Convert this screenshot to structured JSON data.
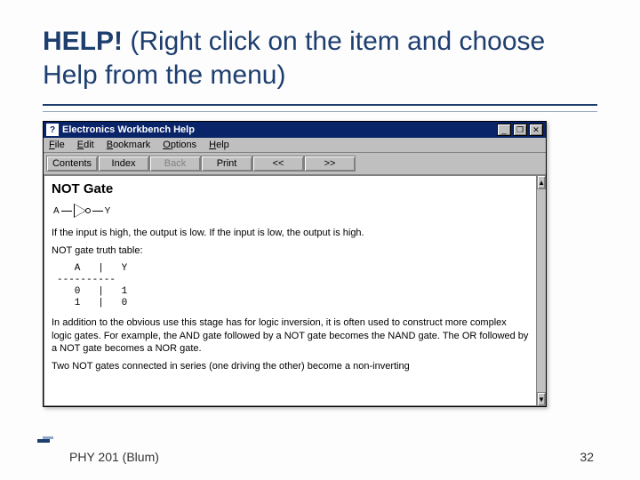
{
  "slide": {
    "title_bold": "HELP!",
    "title_rest": " (Right click on the item and choose Help from the menu)",
    "footer_left": "PHY 201 (Blum)",
    "footer_right": "32"
  },
  "helpwin": {
    "title": "Electronics Workbench Help",
    "menus": [
      "File",
      "Edit",
      "Bookmark",
      "Options",
      "Help"
    ],
    "toolbar": [
      {
        "label": "Contents",
        "enabled": true
      },
      {
        "label": "Index",
        "enabled": true
      },
      {
        "label": "Back",
        "enabled": false
      },
      {
        "label": "Print",
        "enabled": true
      },
      {
        "label": "<<",
        "enabled": true
      },
      {
        "label": ">>",
        "enabled": true
      }
    ],
    "content": {
      "heading": "NOT Gate",
      "gate_in": "A",
      "gate_out": "Y",
      "para1": "If the input is high, the output is low. If the input is low, the output is high.",
      "para2": "NOT gate truth table:",
      "truth": "   A   |   Y\n----------\n   0   |   1\n   1   |   0",
      "para3": "In addition to the obvious use this stage has for logic inversion, it is often used to construct more complex logic gates. For example, the AND gate followed by a NOT gate becomes the NAND gate. The OR followed by a NOT gate becomes a NOR gate.",
      "para4": "Two NOT gates connected in series (one driving the other) become a non-inverting"
    },
    "winbtns": {
      "min": "_",
      "max": "❐",
      "close": "✕"
    }
  }
}
